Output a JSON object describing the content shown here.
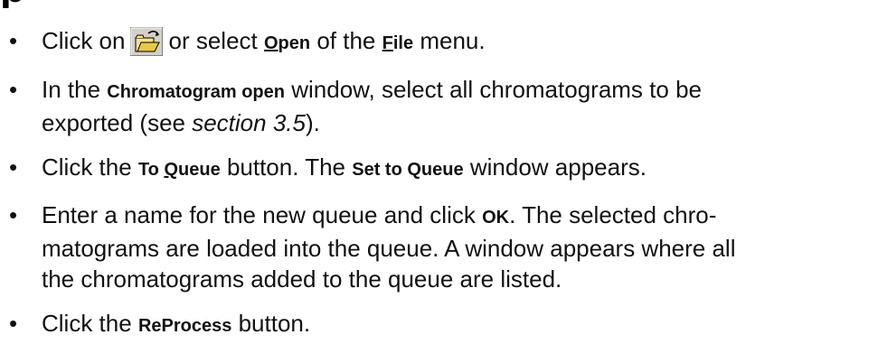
{
  "heading": {
    "partial_text": "p"
  },
  "steps": [
    {
      "a": "Click on",
      "icon": "open-folder-icon",
      "b": "or select",
      "open_pre": "",
      "open_ul": "O",
      "open_post": "pen",
      "c": "of the",
      "file_ul": "F",
      "file_post": "ile",
      "d": "menu."
    },
    {
      "a": "In the",
      "window": "Chromatogram open",
      "b": "window, select all chromatograms to be",
      "c": "exported (see",
      "ref": "section 3.5",
      "d": ")."
    },
    {
      "a": "Click the",
      "btn_pre": "To ",
      "btn_ul": "Q",
      "btn_post": "ueue",
      "b": "button. The",
      "window": "Set to Queue",
      "c": "window appears."
    },
    {
      "a": "Enter a name for the new queue and click",
      "ok": "OK",
      "b": ". The selected chro-",
      "line2": "matograms are loaded into the queue. A window appears where all",
      "line3": "the chromatograms added to the queue are listed."
    },
    {
      "a": "Click the",
      "btn": "ReProcess",
      "b": "button."
    }
  ],
  "bullet_char": "•"
}
